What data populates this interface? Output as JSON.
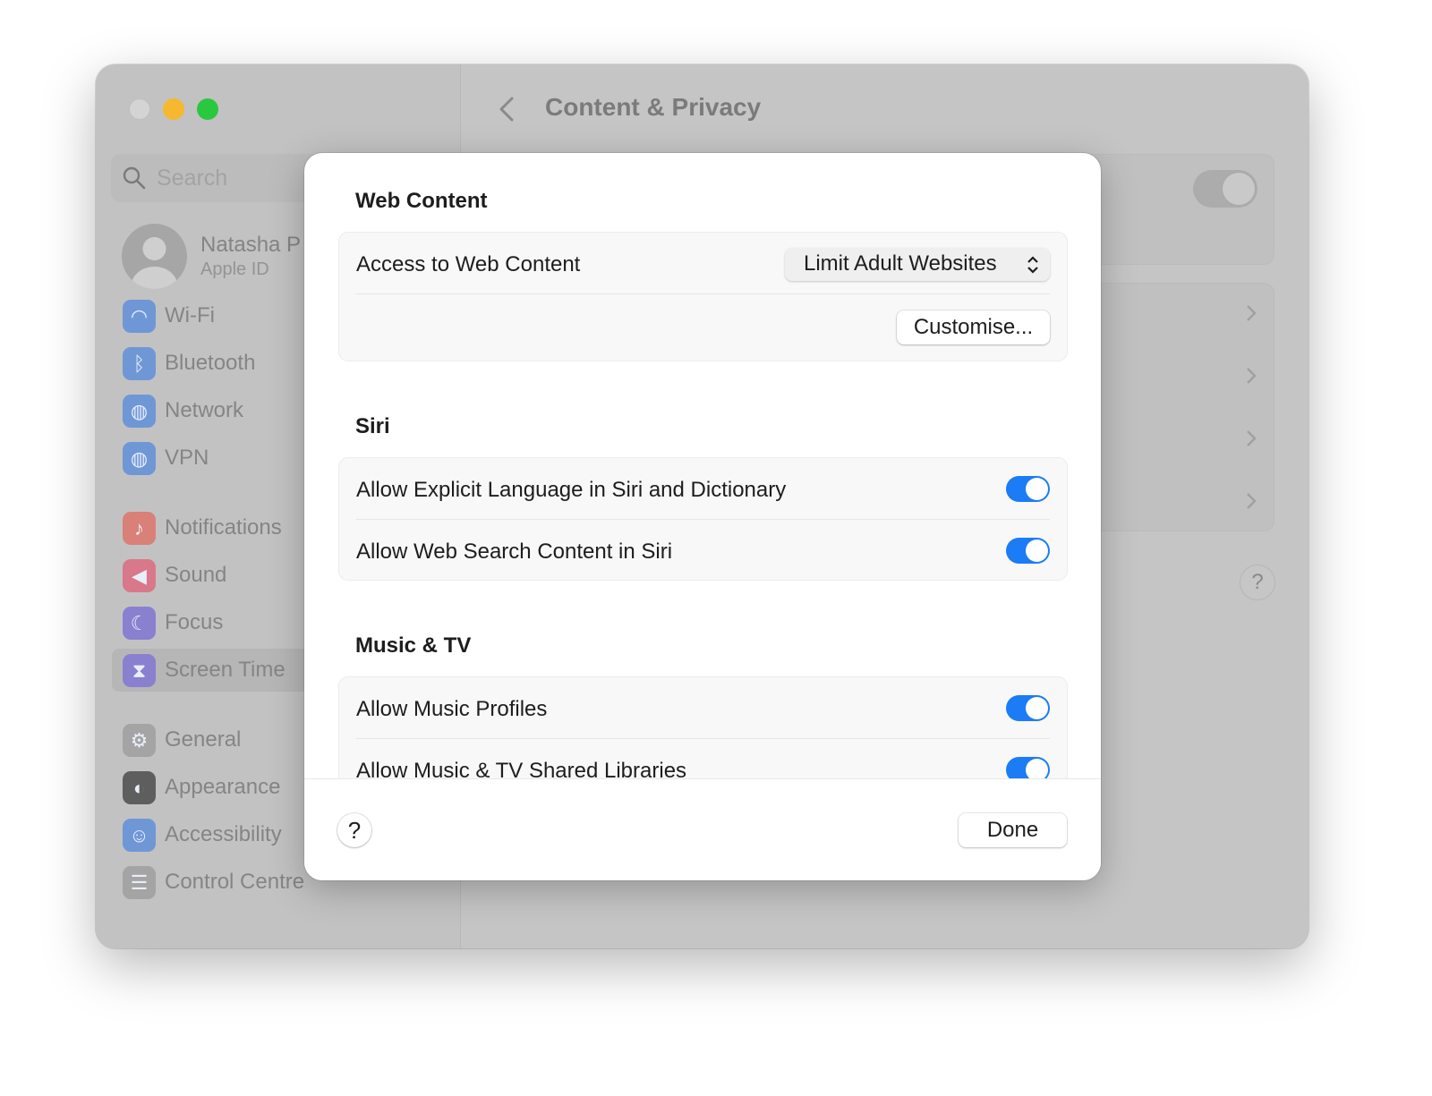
{
  "window": {
    "traffic_lights": {
      "close": "#d4d4d4",
      "minimize": "#f6b82e",
      "zoom": "#2ac840"
    }
  },
  "sidebar": {
    "search_placeholder": "Search",
    "user": {
      "name": "Natasha P",
      "subtitle": "Apple ID"
    },
    "items": [
      {
        "label": "Wi-Fi",
        "icon": "wifi-icon",
        "color": "#6f97d6"
      },
      {
        "label": "Bluetooth",
        "icon": "bluetooth-icon",
        "color": "#6f97d6"
      },
      {
        "label": "Network",
        "icon": "globe-icon",
        "color": "#6f97d6"
      },
      {
        "label": "VPN",
        "icon": "vpn-globe-icon",
        "color": "#6f97d6"
      },
      {
        "label": "Notifications",
        "icon": "bell-icon",
        "color": "#d98078"
      },
      {
        "label": "Sound",
        "icon": "speaker-icon",
        "color": "#d9788a"
      },
      {
        "label": "Focus",
        "icon": "moon-icon",
        "color": "#8a80d0"
      },
      {
        "label": "Screen Time",
        "icon": "hourglass-icon",
        "color": "#8a80d0",
        "selected": true
      },
      {
        "label": "General",
        "icon": "gear-icon",
        "color": "#a4a4a4"
      },
      {
        "label": "Appearance",
        "icon": "appearance-icon",
        "color": "#5e5e5e"
      },
      {
        "label": "Accessibility",
        "icon": "accessibility-icon",
        "color": "#6f97d6"
      },
      {
        "label": "Control Centre",
        "icon": "switches-icon",
        "color": "#a4a4a4"
      }
    ]
  },
  "main": {
    "title": "Content & Privacy",
    "help": "?",
    "main_toggle_on": false
  },
  "dialog": {
    "sections": [
      {
        "heading": "Web Content",
        "access_label": "Access to Web Content",
        "access_value": "Limit Adult Websites",
        "customise": "Customise..."
      },
      {
        "heading": "Siri",
        "rows": [
          {
            "label": "Allow Explicit Language in Siri and Dictionary",
            "on": true
          },
          {
            "label": "Allow Web Search Content in Siri",
            "on": true
          }
        ]
      },
      {
        "heading": "Music & TV",
        "rows": [
          {
            "label": "Allow Music Profiles",
            "on": true
          },
          {
            "label": "Allow Music & TV Shared Libraries",
            "on": true
          }
        ]
      }
    ],
    "help": "?",
    "done": "Done",
    "accent": "#1b7cf5"
  }
}
